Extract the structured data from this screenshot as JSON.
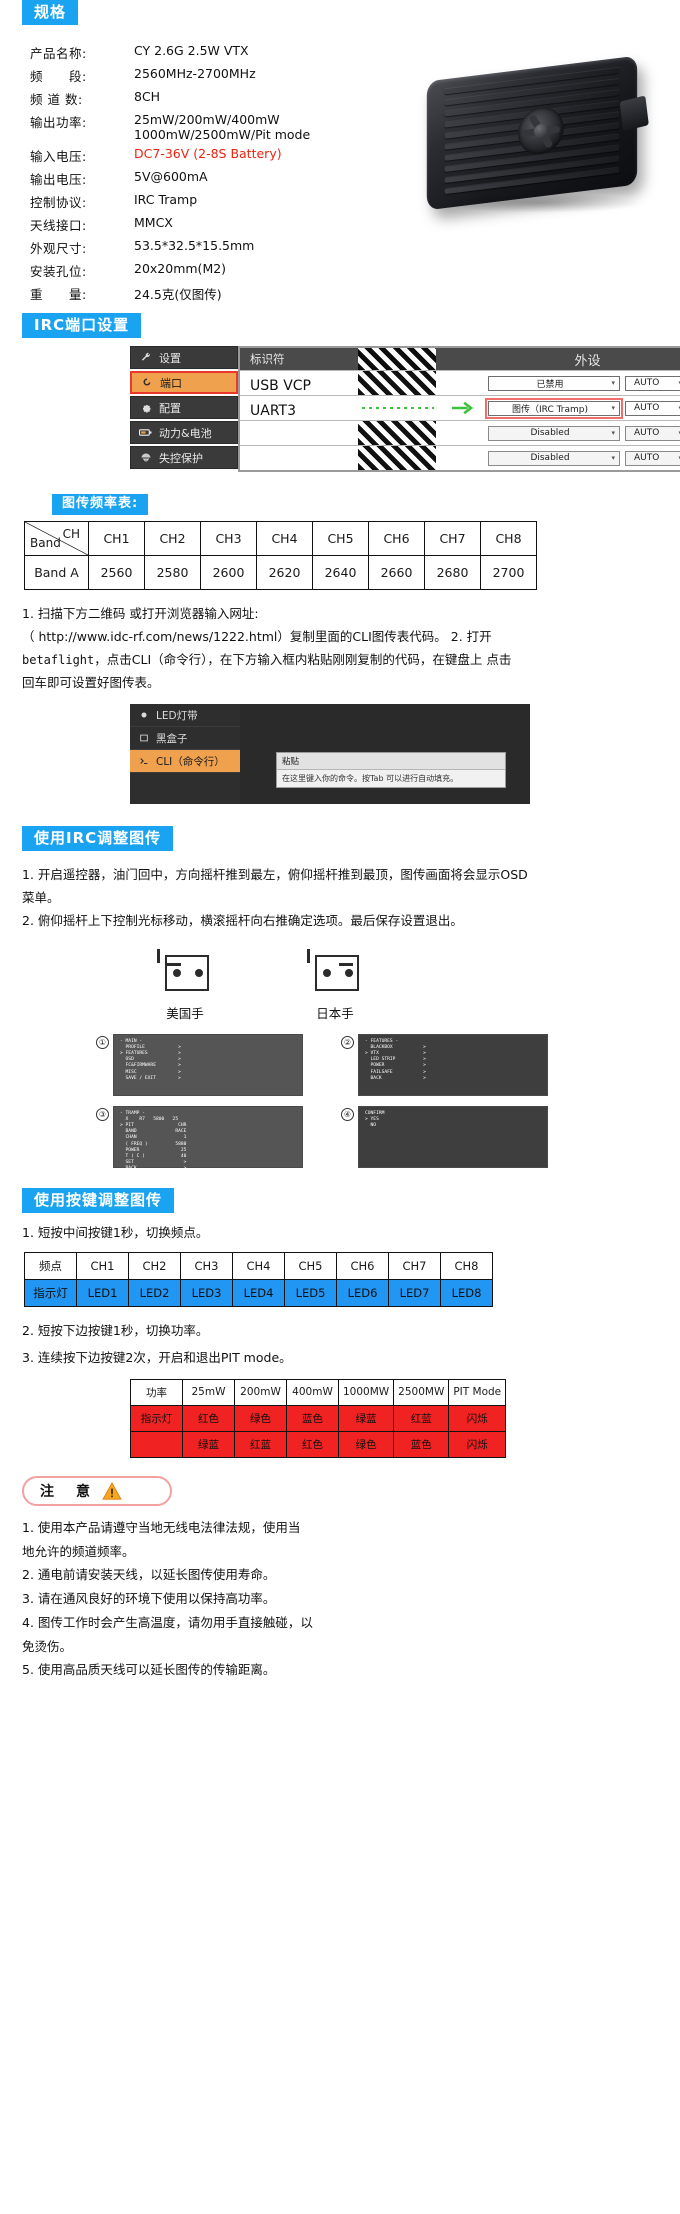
{
  "spec": {
    "heading": "规格",
    "rows": [
      {
        "label": "产品名称:",
        "value": "CY 2.6G  2.5W  VTX",
        "red": false
      },
      {
        "label": "频　　段:",
        "value": "2560MHz-2700MHz",
        "red": false
      },
      {
        "label": "频 道 数:",
        "value": "8CH",
        "red": false
      },
      {
        "label": "输出功率:",
        "value": "25mW/200mW/400mW",
        "value2": "1000mW/2500mW/Pit mode",
        "red": false
      },
      {
        "label": "输入电压:",
        "value": "DC7-36V  (2-8S Battery)",
        "red": true
      },
      {
        "label": "输出电压:",
        "value": "5V@600mA",
        "red": false
      },
      {
        "label": "控制协议:",
        "value": "IRC Tramp",
        "red": false
      },
      {
        "label": "天线接口:",
        "value": "MMCX",
        "red": false
      },
      {
        "label": "外观尺寸:",
        "value": "53.5*32.5*15.5mm",
        "red": false
      },
      {
        "label": "安装孔位:",
        "value": "20x20mm(M2)",
        "red": false
      },
      {
        "label": "重　　量:",
        "value": "24.5克(仅图传)",
        "red": false
      }
    ]
  },
  "ports": {
    "heading": "IRC端口设置",
    "sidebar": [
      {
        "label": "设置",
        "icon": "wrench-icon",
        "active": false
      },
      {
        "label": "端口",
        "icon": "plug-icon",
        "active": true
      },
      {
        "label": "配置",
        "icon": "gear-icon",
        "active": false
      },
      {
        "label": "动力&电池",
        "icon": "battery-icon",
        "active": false
      },
      {
        "label": "失控保护",
        "icon": "parachute-icon",
        "active": false
      }
    ],
    "columns": {
      "identifier": "标识符",
      "peripheral": "外设"
    },
    "rows": [
      {
        "id": "USB VCP",
        "peripheral": "已禁用",
        "baud": "AUTO",
        "highlight": false,
        "arrow": false
      },
      {
        "id": "UART3",
        "peripheral": "图传（IRC Tramp)",
        "baud": "AUTO",
        "highlight": true,
        "arrow": true
      },
      {
        "id": "",
        "peripheral": "Disabled",
        "baud": "AUTO",
        "highlight": false,
        "arrow": false
      },
      {
        "id": "",
        "peripheral": "Disabled",
        "baud": "AUTO",
        "highlight": false,
        "arrow": false
      }
    ]
  },
  "freq": {
    "heading": "图传频率表:",
    "corner_ch": "CH",
    "corner_band": "Band",
    "channels": [
      "CH1",
      "CH2",
      "CH3",
      "CH4",
      "CH5",
      "CH6",
      "CH7",
      "CH8"
    ],
    "band_name": "Band A",
    "values": [
      2560,
      2580,
      2600,
      2620,
      2640,
      2660,
      2680,
      2700
    ]
  },
  "cli": {
    "step1": "1. 扫描下方二维码 或打开浏览器输入网址:",
    "step1b": "（ http://www.idc-rf.com/news/1222.html）复制里面的CLI图传表代码。  2. 打开",
    "step1c_mono": "betaflight",
    "step1d": "，点击CLI（命令行），在下方输入框内粘贴刚刚复制的代码，在键盘上 点击",
    "step1e": "回车即可设置好图传表。",
    "sidebar": [
      {
        "label": "LED灯带",
        "icon": "led-icon",
        "active": false
      },
      {
        "label": "黑盒子",
        "icon": "box-icon",
        "active": false
      },
      {
        "label": "CLI（命令行）",
        "icon": "terminal-icon",
        "active": true
      }
    ],
    "tip_title": "粘贴",
    "tip_body": "在这里键入你的命令。按Tab 可以进行自动填充。"
  },
  "irc_adjust": {
    "heading": "使用IRC调整图传",
    "line1": "1. 开启遥控器，油门回中，方向摇杆推到最左，俯仰摇杆推到最顶，图传画面将会显示OSD",
    "line1b": "菜单。",
    "line2": "2. 俯仰摇杆上下控制光标移动，横滚摇杆向右推确定选项。最后保存设置退出。",
    "hand_left": "美国手",
    "hand_right": "日本手",
    "osd": [
      {
        "num": "①",
        "lines": [
          "- MAIN -",
          "  PROFILE            >",
          "> FEATURES           >",
          "  OSD                >",
          "  FC&FIRMWARE        >",
          "  MISC               >",
          "  SAVE / EXIT        >"
        ]
      },
      {
        "num": "②",
        "lines": [
          "- FEATURES -",
          "  BLACKBOX           >",
          "> VTX                >",
          "  LED STRIP          >",
          "  POWER              >",
          "  FAILSAFE           >",
          "  BACK               >"
        ]
      },
      {
        "num": "③",
        "lines": [
          "- TRAMP -",
          "  X    R7   5800   25",
          "> PIT                CHR",
          "  BAND              RACE",
          "  CHAN                 1",
          "  ( FREQ )          5880",
          "  POWER               25",
          "  T ( C )             40",
          "  SET                  >",
          "  BACK                 >"
        ]
      },
      {
        "num": "④",
        "lines": [
          "CONFIRM",
          "> YES",
          "  NO"
        ]
      }
    ]
  },
  "button_adjust": {
    "heading": "使用按键调整图传",
    "line1": "1. 短按中间按键1秒，切换频点。",
    "line2": "2. 短按下边按键1秒，切换功率。",
    "line3": "3. 连续按下边按键2次，开启和退出PIT mode。",
    "led_table": {
      "row_head": "频点",
      "row_head2": "指示灯",
      "channels": [
        "CH1",
        "CH2",
        "CH3",
        "CH4",
        "CH5",
        "CH6",
        "CH7",
        "CH8"
      ],
      "leds": [
        "LED1",
        "LED2",
        "LED3",
        "LED4",
        "LED5",
        "LED6",
        "LED7",
        "LED8"
      ]
    },
    "power_table": {
      "row_head": "功率",
      "row_head2": "指示灯",
      "powers": [
        "25mW",
        "200mW",
        "400mW",
        "1000MW",
        "2500MW",
        "PIT Mode"
      ],
      "colors_row1": [
        "红色",
        "绿色",
        "蓝色",
        "绿蓝",
        "红蓝",
        "闪烁"
      ],
      "colors_row2": [
        "绿蓝",
        "红蓝",
        "红色",
        "绿色",
        "蓝色",
        "闪烁"
      ]
    }
  },
  "notice": {
    "title": "注　意",
    "items": [
      "1. 使用本产品请遵守当地无线电法律法规，使用当",
      "地允许的频道频率。",
      "2. 通电前请安装天线，以延长图传使用寿命。",
      "3. 请在通风良好的环境下使用以保持高功率。",
      "4. 图传工作时会产生高温度，请勿用手直接触碰，以",
      "免烫伤。",
      "5. 使用高品质天线可以延长图传的传输距离。"
    ]
  },
  "colors": {
    "accent": "#1aa3f0",
    "red": "#ee2211",
    "orange": "#efa14e",
    "blue_cell": "#2196f3",
    "red_cell": "#f12222"
  }
}
